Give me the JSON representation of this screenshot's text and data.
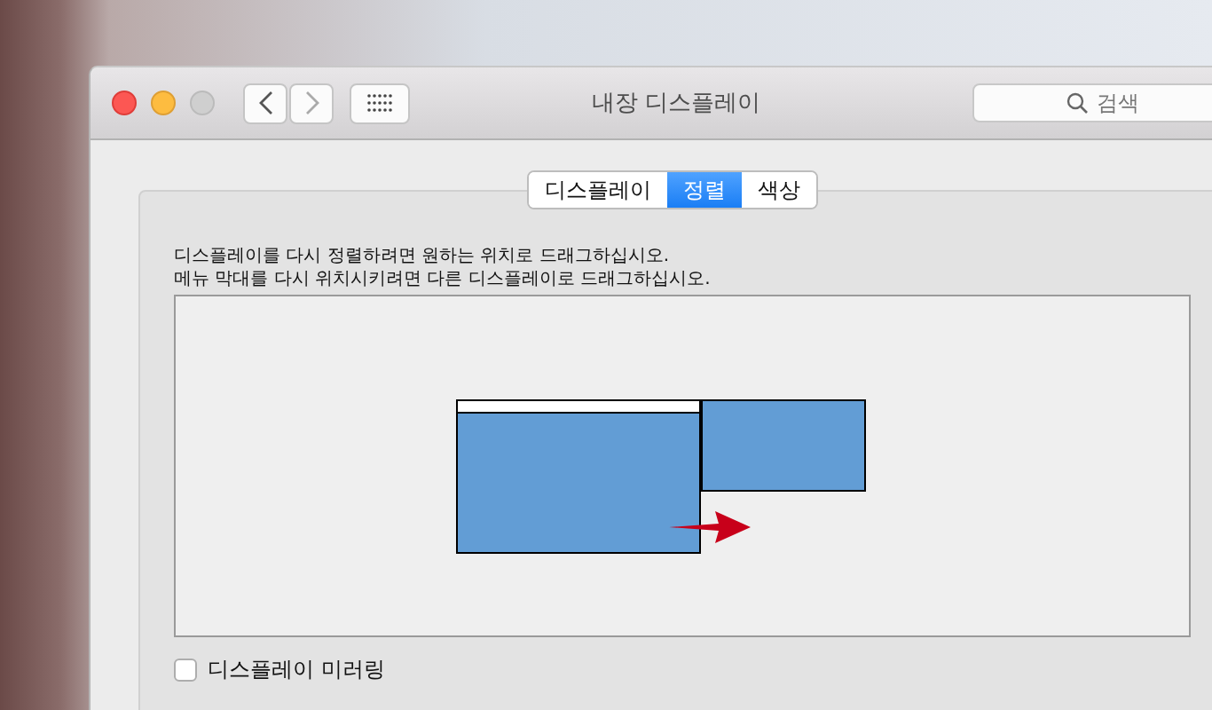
{
  "window": {
    "title": "내장 디스플레이"
  },
  "search": {
    "placeholder": "검색"
  },
  "tabs": [
    {
      "label": "디스플레이",
      "selected": false
    },
    {
      "label": "정렬",
      "selected": true
    },
    {
      "label": "색상",
      "selected": false
    }
  ],
  "instructions": [
    "디스플레이를 다시 정렬하려면 원하는 위치로 드래그하십시오.",
    "메뉴 막대를 다시 위치시키려면 다른 디스플레이로 드래그하십시오."
  ],
  "mirroring": {
    "label": "디스플레이 미러링",
    "checked": false
  }
}
